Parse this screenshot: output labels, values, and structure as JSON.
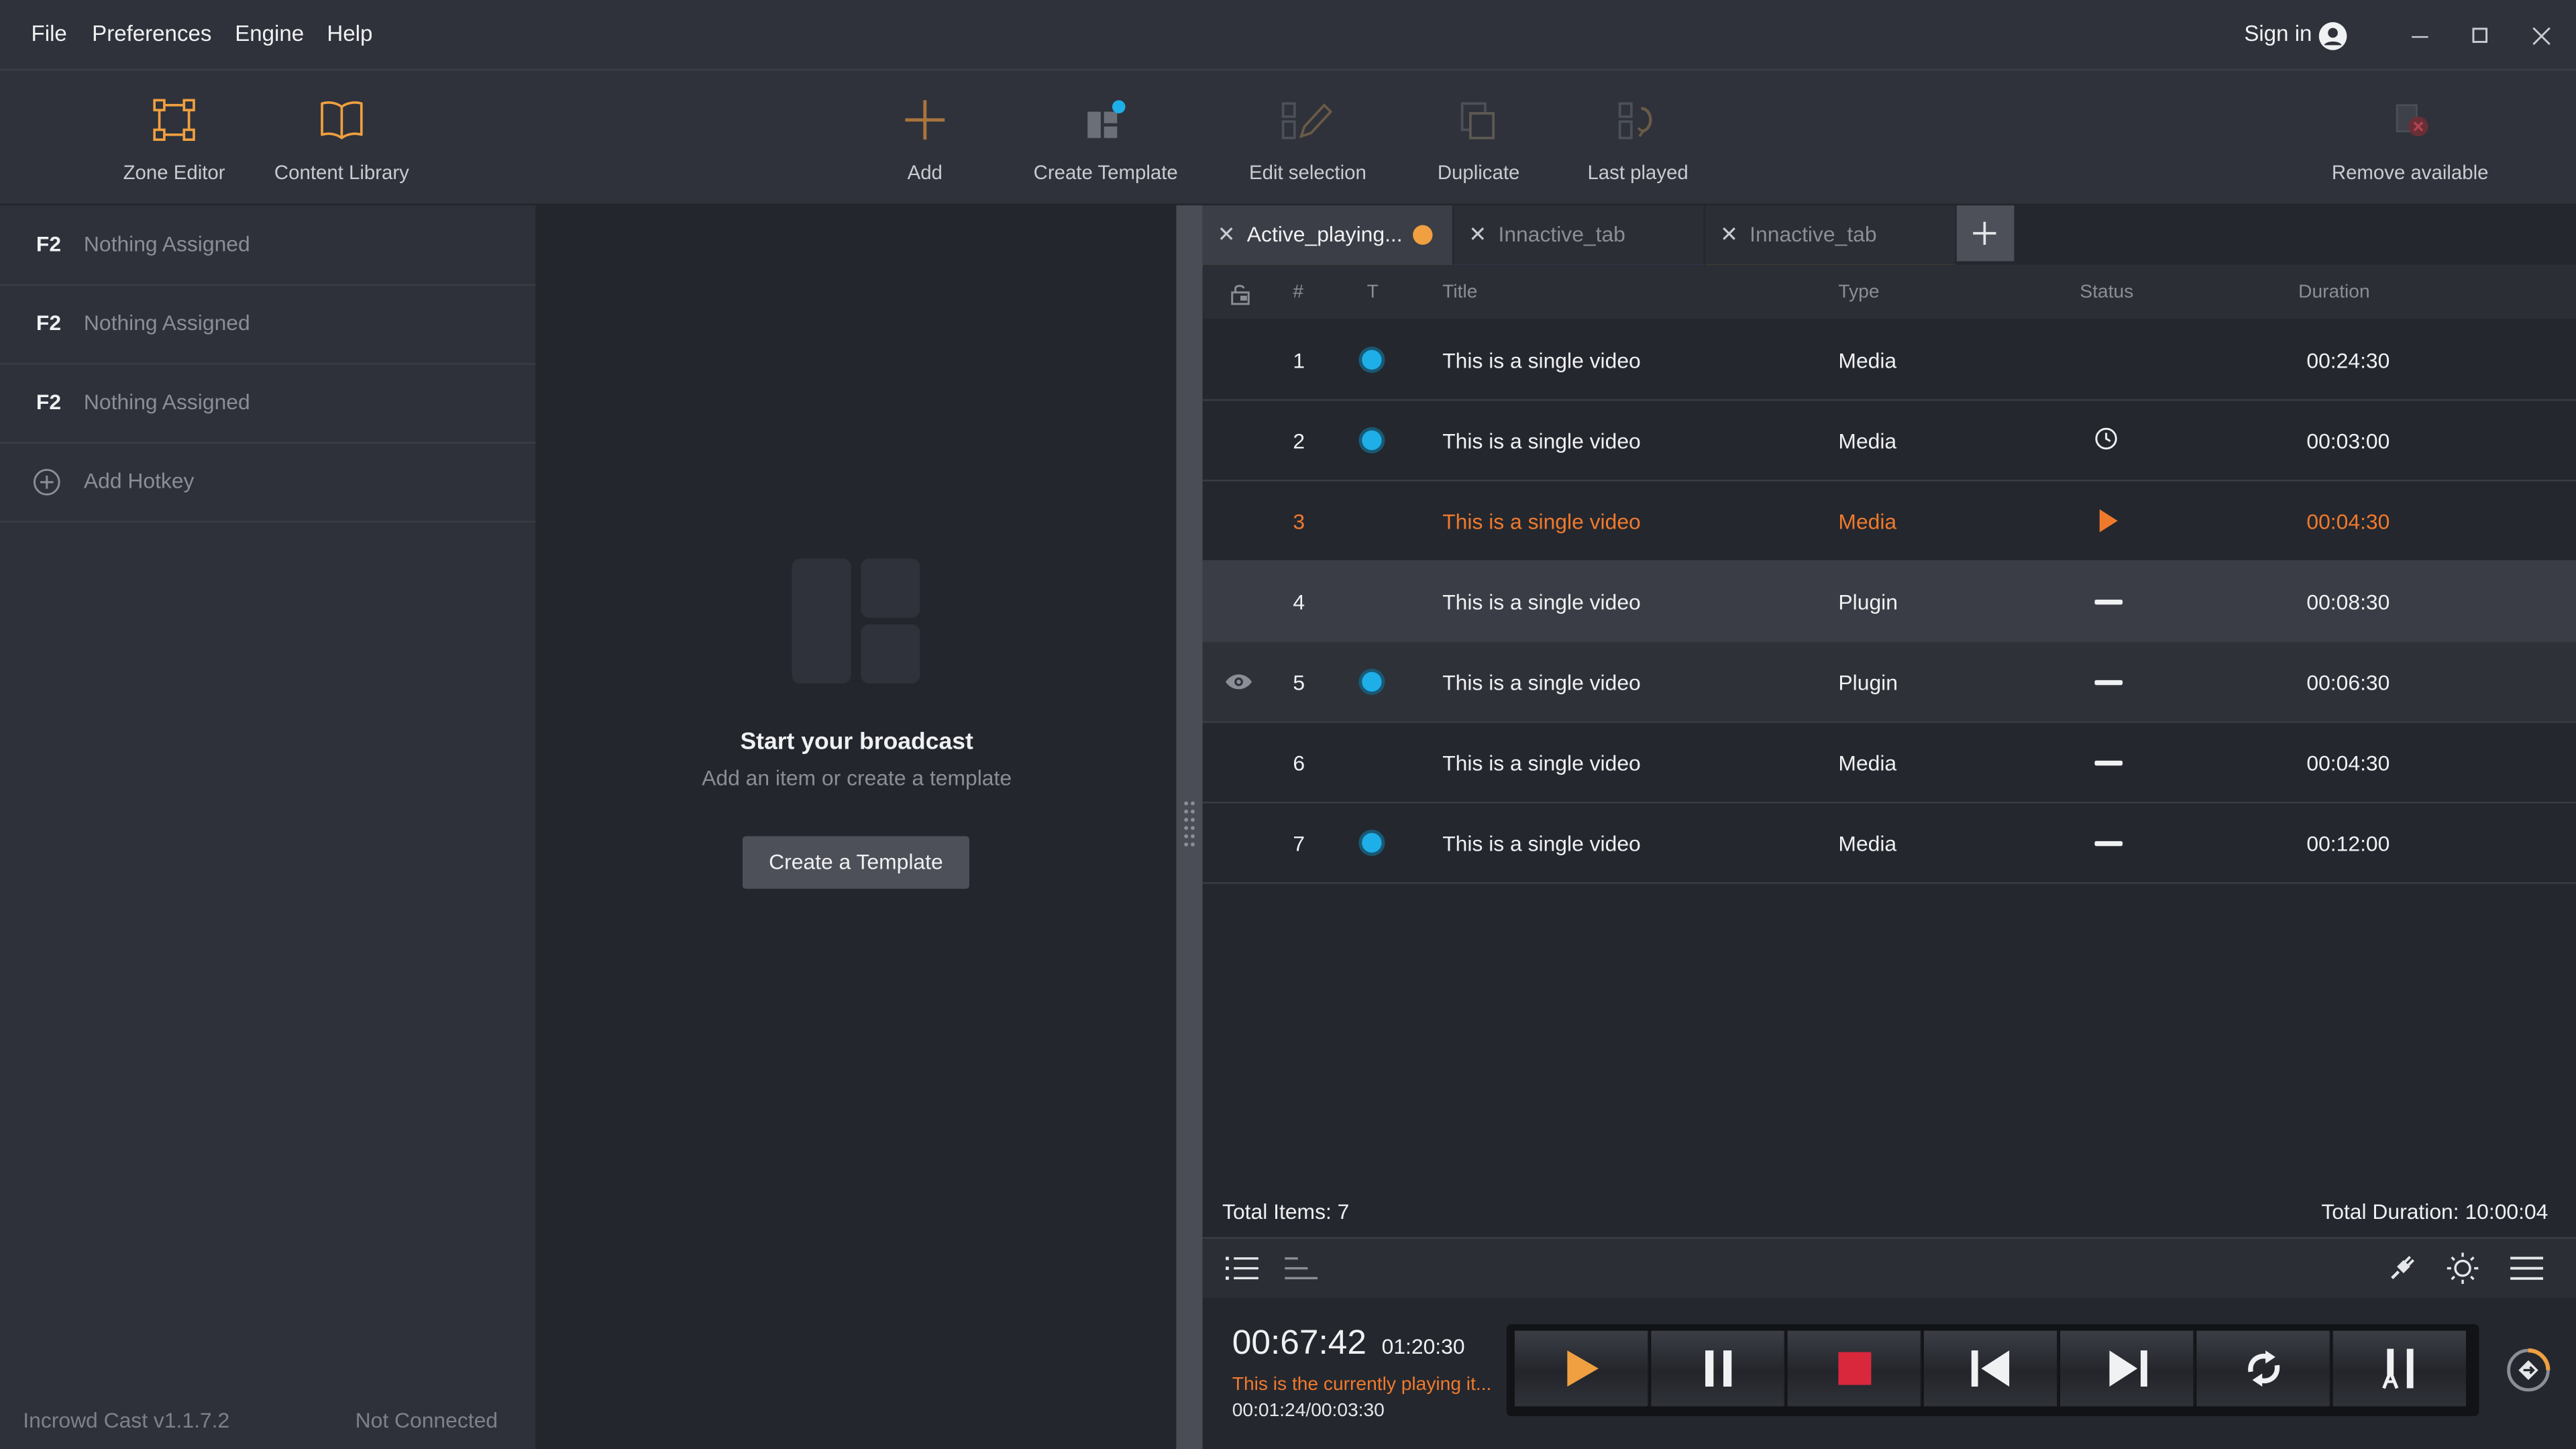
{
  "menu": [
    "File",
    "Preferences",
    "Engine",
    "Help"
  ],
  "account": {
    "sign_in": "Sign in"
  },
  "toolbar": {
    "zone_editor": "Zone Editor",
    "content_library": "Content Library",
    "add": "Add",
    "create_template": "Create Template",
    "edit_selection": "Edit selection",
    "duplicate": "Duplicate",
    "last_played": "Last played",
    "remove_available": "Remove available"
  },
  "hotkeys": {
    "items": [
      {
        "key": "F2",
        "label": "Nothing Assigned"
      },
      {
        "key": "F2",
        "label": "Nothing Assigned"
      },
      {
        "key": "F2",
        "label": "Nothing Assigned"
      }
    ],
    "add_label": "Add Hotkey",
    "version": "Incrowd Cast v1.1.7.2",
    "connection": "Not Connected"
  },
  "empty_state": {
    "title": "Start your broadcast",
    "subtitle": "Add an item or create a template",
    "button": "Create a Template"
  },
  "tabs": [
    {
      "label": "Active_playing...",
      "accent": "#8bc34a"
    },
    {
      "label": "Innactive_tab",
      "accent": "#9b59d6"
    },
    {
      "label": "Innactive_tab",
      "accent": "#e0b422"
    }
  ],
  "table": {
    "headers": {
      "num": "#",
      "t": "T",
      "title": "Title",
      "type": "Type",
      "status": "Status",
      "duration": "Duration"
    },
    "rows": [
      {
        "num": "1",
        "title": "This is a single video",
        "type": "Media",
        "duration": "00:24:30"
      },
      {
        "num": "2",
        "title": "This is a single video",
        "type": "Media",
        "duration": "00:03:00"
      },
      {
        "num": "3",
        "title": "This is a single video",
        "type": "Media",
        "duration": "00:04:30"
      },
      {
        "num": "4",
        "title": "This is a single video",
        "type": "Plugin",
        "duration": "00:08:30"
      },
      {
        "num": "5",
        "title": "This is a single video",
        "type": "Plugin",
        "duration": "00:06:30"
      },
      {
        "num": "6",
        "title": "This is a single video",
        "type": "Media",
        "duration": "00:04:30"
      },
      {
        "num": "7",
        "title": "This is a single video",
        "type": "Media",
        "duration": "00:12:00"
      }
    ]
  },
  "totals": {
    "items": "Total Items: 7",
    "duration": "Total Duration: 10:00:04"
  },
  "playback": {
    "elapsed": "00:67:42",
    "remaining": "01:20:30",
    "now_playing": "This is the currently playing it...",
    "progress": "00:01:24/00:03:30"
  },
  "colors": {
    "accent": "#f07a2c",
    "indicator": "#1eaee8"
  }
}
